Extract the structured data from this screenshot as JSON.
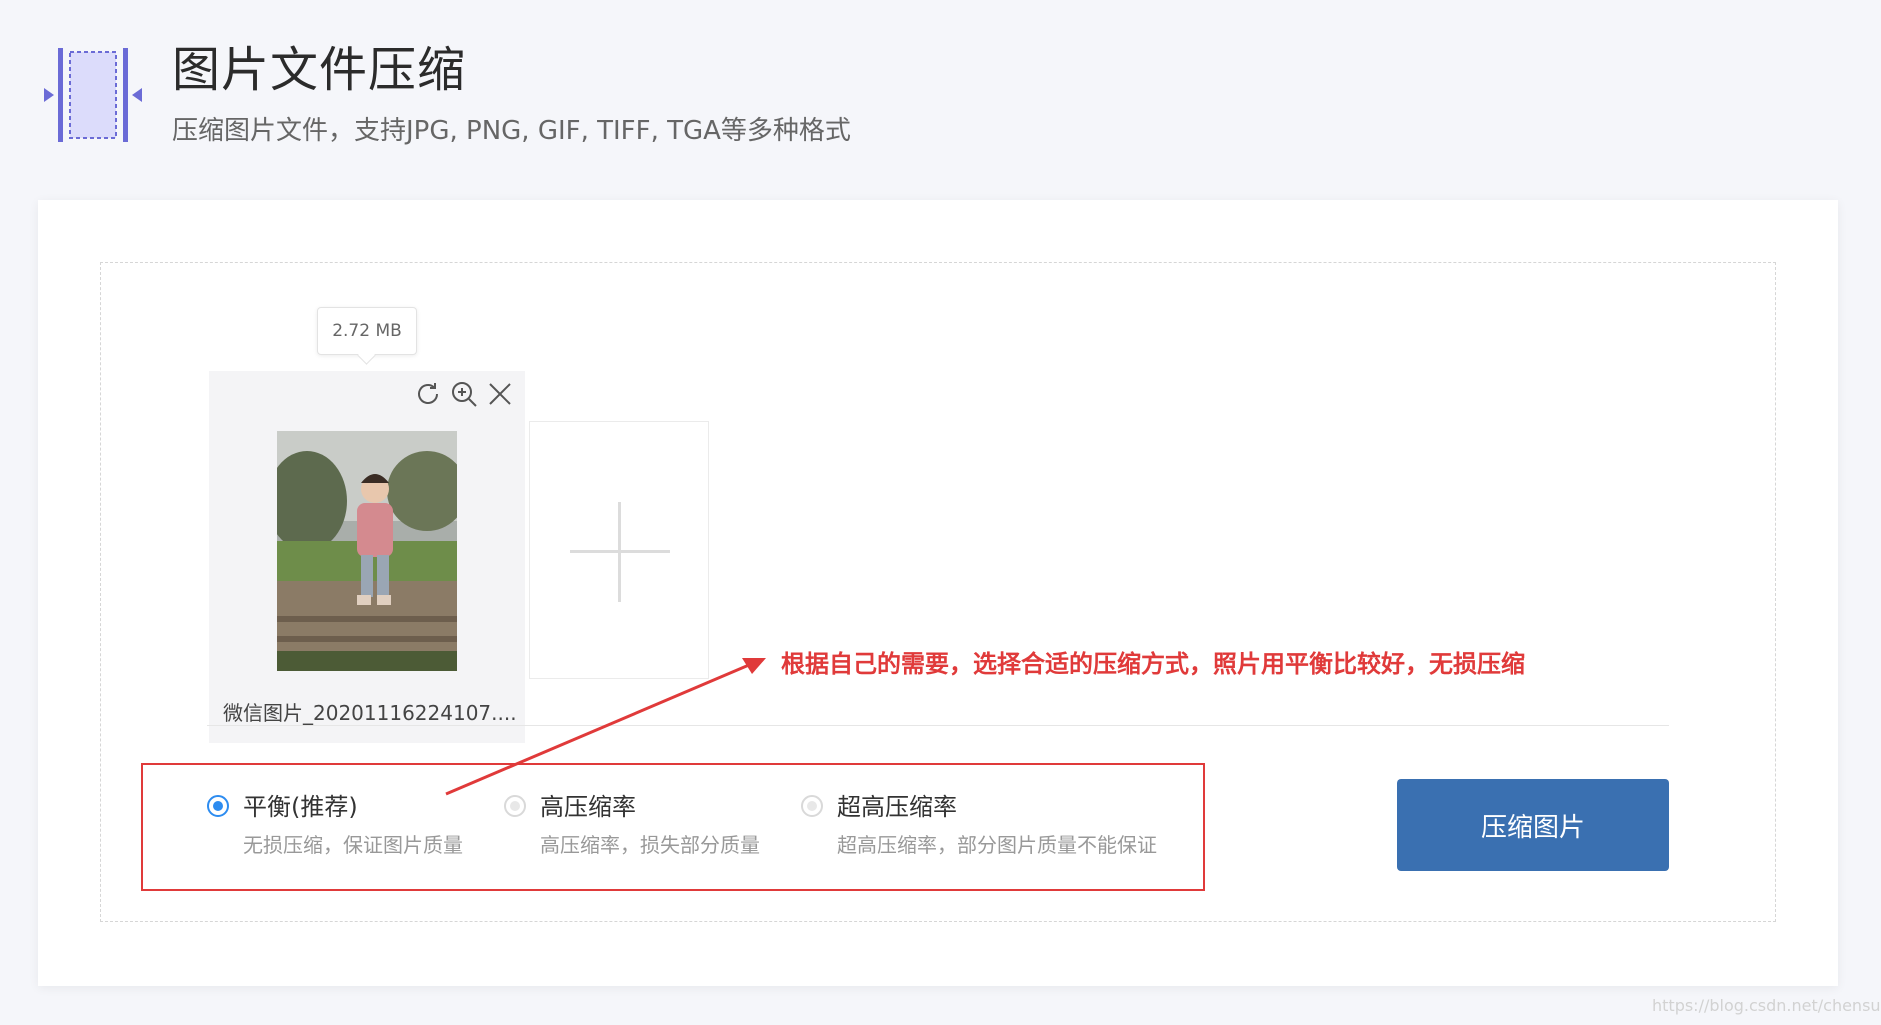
{
  "header": {
    "logo_icon": "compress-logo-icon",
    "title": "图片文件压缩",
    "subtitle": "压缩图片文件，支持JPG, PNG, GIF, TIFF, TGA等多种格式"
  },
  "file": {
    "size": "2.72 MB",
    "name": "微信图片_20201116224107....",
    "actions": [
      "rotate-icon",
      "zoom-in-icon",
      "close-icon"
    ]
  },
  "add_tile": {
    "icon": "plus-icon"
  },
  "annotation": {
    "text": "根据自己的需要，选择合适的压缩方式，照片用平衡比较好，无损压缩",
    "color": "#e03a3a"
  },
  "options": [
    {
      "label": "平衡(推荐)",
      "desc": "无损压缩，保证图片质量",
      "selected": true
    },
    {
      "label": "高压缩率",
      "desc": "高压缩率，损失部分质量",
      "selected": false
    },
    {
      "label": "超高压缩率",
      "desc": "超高压缩率，部分图片质量不能保证",
      "selected": false
    }
  ],
  "compress_button": {
    "label": "压缩图片",
    "color": "#3a70b1"
  },
  "colors": {
    "accent": "#2d8cf0",
    "background": "#f5f6fa"
  },
  "watermark": "https://blog.csdn.net/chensuper"
}
